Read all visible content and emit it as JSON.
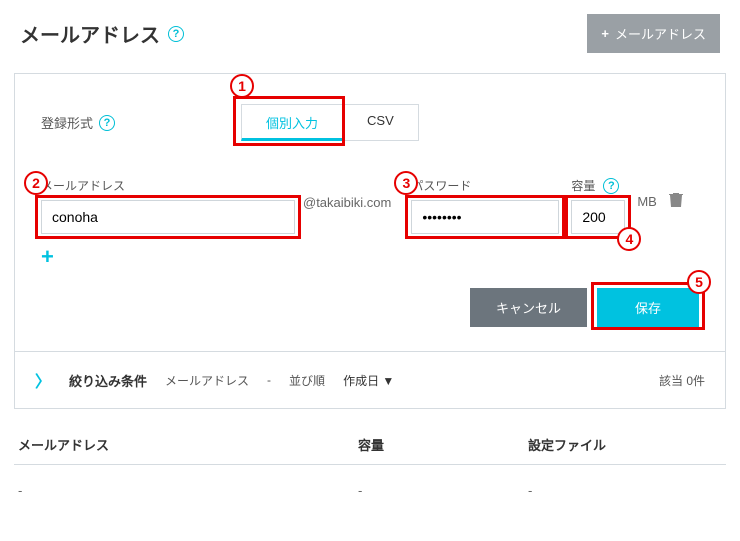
{
  "header": {
    "title": "メールアドレス",
    "add_button": "メールアドレス"
  },
  "form": {
    "registration_type_label": "登録形式",
    "tabs": {
      "individual": "個別入力",
      "csv": "CSV"
    },
    "email_label": "メールアドレス",
    "email_value": "conoha",
    "domain": "@takaibiki.com",
    "password_label": "パスワード",
    "password_value": "••••••••",
    "capacity_label": "容量",
    "capacity_value": "200",
    "capacity_unit": "MB"
  },
  "actions": {
    "cancel": "キャンセル",
    "save": "保存"
  },
  "filter": {
    "title": "絞り込み条件",
    "mail_label": "メールアドレス",
    "mail_value": "-",
    "sort_label": "並び順",
    "sort_value": "作成日 ▼",
    "count": "該当 0件"
  },
  "table": {
    "columns": {
      "email": "メールアドレス",
      "capacity": "容量",
      "file": "設定ファイル"
    },
    "rows": [
      {
        "email": "-",
        "capacity": "-",
        "file": "-"
      }
    ]
  },
  "callouts": {
    "c1": "1",
    "c2": "2",
    "c3": "3",
    "c4": "4",
    "c5": "5"
  }
}
